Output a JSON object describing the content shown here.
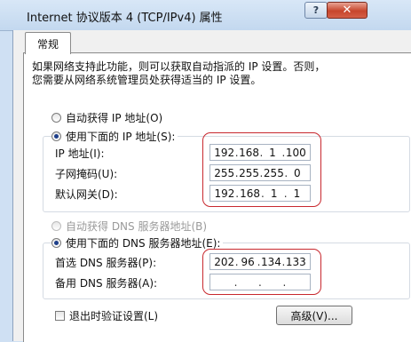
{
  "window": {
    "title": "Internet 协议版本 4 (TCP/IPv4) 属性",
    "help_label": "?",
    "close_label": "✕"
  },
  "tabs": [
    {
      "label": "常规"
    }
  ],
  "description": {
    "line1": "如果网络支持此功能，则可以获取自动指派的 IP 设置。否则，",
    "line2": "您需要从网络系统管理员处获得适当的 IP 设置。"
  },
  "ip_section": {
    "auto_label": "自动获得 IP 地址(O)",
    "auto_selected": false,
    "manual_label": "使用下面的 IP 地址(S):",
    "manual_selected": true,
    "fields": [
      {
        "label": "IP 地址(I):",
        "octets": [
          "192",
          "168",
          "1",
          "100"
        ]
      },
      {
        "label": "子网掩码(U):",
        "octets": [
          "255",
          "255",
          "255",
          "0"
        ]
      },
      {
        "label": "默认网关(D):",
        "octets": [
          "192",
          "168",
          "1",
          "1"
        ]
      }
    ]
  },
  "dns_section": {
    "auto_label": "自动获得 DNS 服务器地址(B)",
    "auto_selected": false,
    "auto_disabled": true,
    "manual_label": "使用下面的 DNS 服务器地址(E):",
    "manual_selected": true,
    "fields": [
      {
        "label": "首选 DNS 服务器(P):",
        "octets": [
          "202",
          "96",
          "134",
          "133"
        ]
      },
      {
        "label": "备用 DNS 服务器(A):",
        "octets": [
          "",
          "",
          "",
          ""
        ]
      }
    ]
  },
  "validate_on_exit": {
    "label": "退出时验证设置(L)",
    "checked": false
  },
  "advanced_button": {
    "label": "高级(V)..."
  },
  "colors": {
    "annotation_ring": "#c8282e",
    "title_bar": "#c3d8ef"
  }
}
